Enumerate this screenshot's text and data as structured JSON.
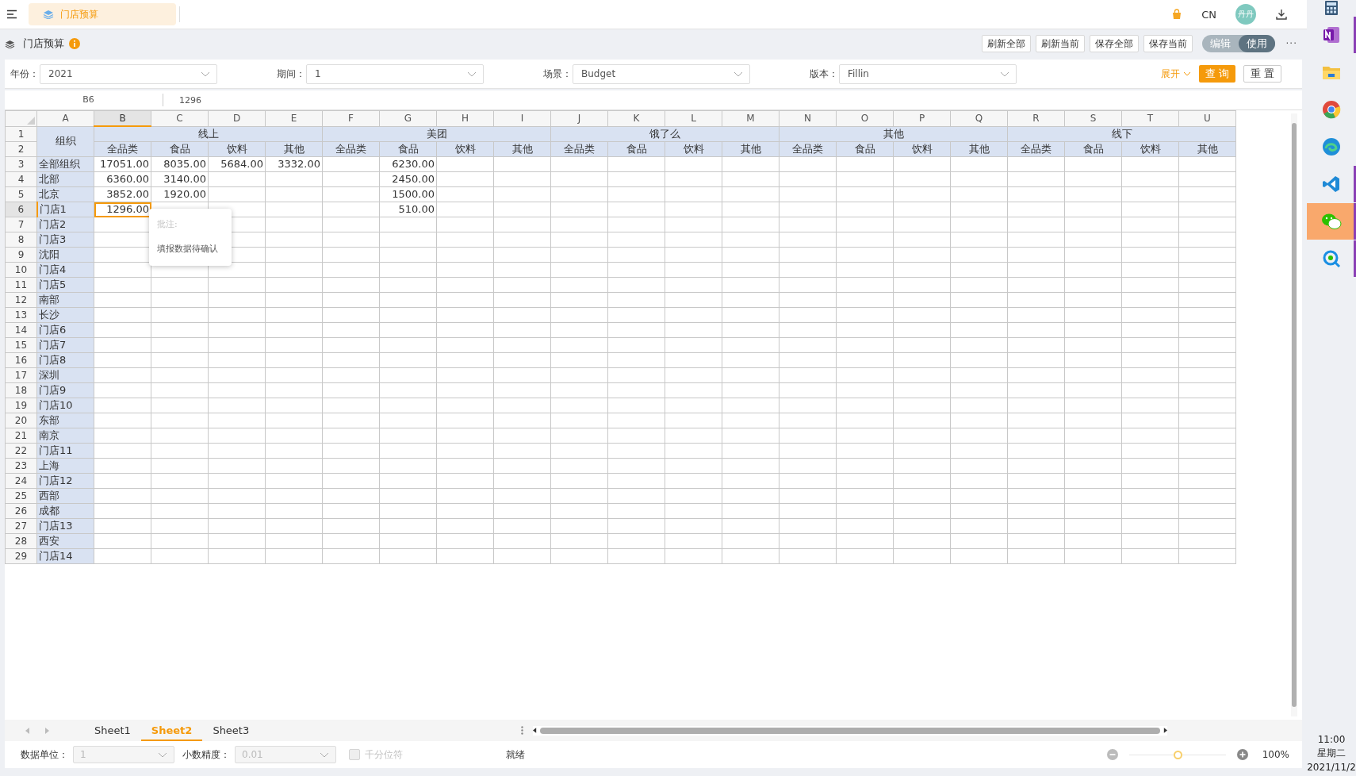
{
  "top_bar": {
    "tab": {
      "label": "门店预算",
      "selected": true
    },
    "language": "CN",
    "avatar": "丹丹"
  },
  "title_bar": {
    "title": "门店预算",
    "buttons": [
      "刷新全部",
      "刷新当前",
      "保存全部",
      "保存当前"
    ],
    "mode_toggle": [
      {
        "label": "编辑",
        "selected": false
      },
      {
        "label": "使用",
        "selected": true
      }
    ],
    "more": "···"
  },
  "filters": [
    {
      "label": "年份：",
      "value": "2021"
    },
    {
      "label": "期间：",
      "value": "1"
    },
    {
      "label": "场景：",
      "value": "Budget"
    },
    {
      "label": "版本：",
      "value": "Fillin"
    }
  ],
  "filter_actions": {
    "expand": "展开",
    "query": "查 询",
    "reset": "重 置"
  },
  "formula_bar": {
    "cell_ref": "B6",
    "value": "1296"
  },
  "grid": {
    "columns": [
      {
        "label": "A",
        "selected": false
      },
      {
        "label": "B",
        "selected": true
      },
      {
        "label": "C",
        "selected": false
      },
      {
        "label": "D",
        "selected": false
      },
      {
        "label": "E",
        "selected": false
      },
      {
        "label": "F",
        "selected": false
      },
      {
        "label": "G",
        "selected": false
      },
      {
        "label": "H",
        "selected": false
      },
      {
        "label": "I",
        "selected": false
      },
      {
        "label": "J",
        "selected": false
      },
      {
        "label": "K",
        "selected": false
      },
      {
        "label": "L",
        "selected": false
      },
      {
        "label": "M",
        "selected": false
      },
      {
        "label": "N",
        "selected": false
      },
      {
        "label": "O",
        "selected": false
      },
      {
        "label": "P",
        "selected": false
      },
      {
        "label": "Q",
        "selected": false
      },
      {
        "label": "R",
        "selected": false
      },
      {
        "label": "S",
        "selected": false
      },
      {
        "label": "T",
        "selected": false
      },
      {
        "label": "U",
        "selected": false
      }
    ],
    "header_row_numbers": [
      "1",
      "2"
    ],
    "corner_label": "组织",
    "groups": [
      {
        "label": "线上",
        "items": [
          "全品类",
          "食品",
          "饮料",
          "其他"
        ]
      },
      {
        "label": "美团",
        "items": [
          "全品类",
          "食品",
          "饮料",
          "其他"
        ]
      },
      {
        "label": "饿了么",
        "items": [
          "全品类",
          "食品",
          "饮料",
          "其他"
        ]
      },
      {
        "label": "其他",
        "items": [
          "全品类",
          "食品",
          "饮料",
          "其他"
        ]
      },
      {
        "label": "线下",
        "items": [
          "全品类",
          "食品",
          "饮料",
          "其他"
        ]
      }
    ],
    "rows": [
      {
        "number": "3",
        "org": "全部组织",
        "selected": false,
        "values": [
          {
            "kind": "number",
            "value": "17051.00"
          },
          {
            "kind": "number",
            "value": "8035.00"
          },
          {
            "kind": "number",
            "value": "5684.00"
          },
          {
            "kind": "number",
            "value": "3332.00"
          },
          {
            "kind": "empty"
          },
          {
            "kind": "number",
            "value": "6230.00"
          }
        ]
      },
      {
        "number": "4",
        "org": "北部",
        "selected": false,
        "values": [
          {
            "kind": "number",
            "value": "6360.00"
          },
          {
            "kind": "number",
            "value": "3140.00"
          },
          {
            "kind": "empty"
          },
          {
            "kind": "empty"
          },
          {
            "kind": "empty"
          },
          {
            "kind": "number",
            "value": "2450.00"
          }
        ]
      },
      {
        "number": "5",
        "org": "北京",
        "selected": false,
        "values": [
          {
            "kind": "number",
            "value": "3852.00"
          },
          {
            "kind": "number",
            "value": "1920.00"
          },
          {
            "kind": "empty"
          },
          {
            "kind": "empty"
          },
          {
            "kind": "empty"
          },
          {
            "kind": "number",
            "value": "1500.00"
          }
        ]
      },
      {
        "number": "6",
        "org": "门店1",
        "selected": true,
        "values": [
          {
            "kind": "number",
            "value": "1296.00"
          },
          {
            "kind": "empty"
          },
          {
            "kind": "empty"
          },
          {
            "kind": "empty"
          },
          {
            "kind": "empty"
          },
          {
            "kind": "number",
            "value": "510.00"
          }
        ]
      },
      {
        "number": "7",
        "org": "门店2",
        "selected": false,
        "values": []
      },
      {
        "number": "8",
        "org": "门店3",
        "selected": false,
        "values": []
      },
      {
        "number": "9",
        "org": "沈阳",
        "selected": false,
        "values": []
      },
      {
        "number": "10",
        "org": "门店4",
        "selected": false,
        "values": []
      },
      {
        "number": "11",
        "org": "门店5",
        "selected": false,
        "values": []
      },
      {
        "number": "12",
        "org": "南部",
        "selected": false,
        "values": []
      },
      {
        "number": "13",
        "org": "长沙",
        "selected": false,
        "values": []
      },
      {
        "number": "14",
        "org": "门店6",
        "selected": false,
        "values": []
      },
      {
        "number": "15",
        "org": "门店7",
        "selected": false,
        "values": []
      },
      {
        "number": "16",
        "org": "门店8",
        "selected": false,
        "values": []
      },
      {
        "number": "17",
        "org": "深圳",
        "selected": false,
        "values": []
      },
      {
        "number": "18",
        "org": "门店9",
        "selected": false,
        "values": []
      },
      {
        "number": "19",
        "org": "门店10",
        "selected": false,
        "values": []
      },
      {
        "number": "20",
        "org": "东部",
        "selected": false,
        "values": []
      },
      {
        "number": "21",
        "org": "南京",
        "selected": false,
        "values": []
      },
      {
        "number": "22",
        "org": "门店11",
        "selected": false,
        "values": []
      },
      {
        "number": "23",
        "org": "上海",
        "selected": false,
        "values": []
      },
      {
        "number": "24",
        "org": "门店12",
        "selected": false,
        "values": []
      },
      {
        "number": "25",
        "org": "西部",
        "selected": false,
        "values": []
      },
      {
        "number": "26",
        "org": "成都",
        "selected": false,
        "values": []
      },
      {
        "number": "27",
        "org": "门店13",
        "selected": false,
        "values": []
      },
      {
        "number": "28",
        "org": "西安",
        "selected": false,
        "values": []
      },
      {
        "number": "29",
        "org": "门店14",
        "selected": false,
        "values": []
      }
    ],
    "comment": {
      "title": "批注:",
      "text": "填报数据待确认"
    }
  },
  "sheet_tabs": [
    {
      "label": "Sheet1",
      "selected": false
    },
    {
      "label": "Sheet2",
      "selected": true
    },
    {
      "label": "Sheet3",
      "selected": false
    }
  ],
  "status_bar": {
    "unit": {
      "label": "数据单位：",
      "value": "1",
      "disabled": true
    },
    "precision": {
      "label": "小数精度：",
      "value": "0.01",
      "disabled": true
    },
    "thousands": {
      "label": "千分位符",
      "checked": false,
      "disabled": true
    },
    "status": "就绪",
    "zoom": {
      "level": 0.5,
      "reading": "100%"
    }
  },
  "taskbar": {
    "apps": [
      {
        "kind": "calculator",
        "selected": false,
        "running": false
      },
      {
        "kind": "notebook",
        "selected": false,
        "running": true
      },
      {
        "kind": "folder",
        "selected": false,
        "running": false
      },
      {
        "kind": "browser",
        "selected": false,
        "running": false
      },
      {
        "kind": "wave",
        "selected": false,
        "running": false
      },
      {
        "kind": "code",
        "selected": false,
        "running": true
      },
      {
        "kind": "chat",
        "selected": true,
        "running": true
      },
      {
        "kind": "search-chat",
        "selected": false,
        "running": true
      }
    ],
    "time": "11:00",
    "weekday": "星期二",
    "date": "2021/11/2"
  }
}
